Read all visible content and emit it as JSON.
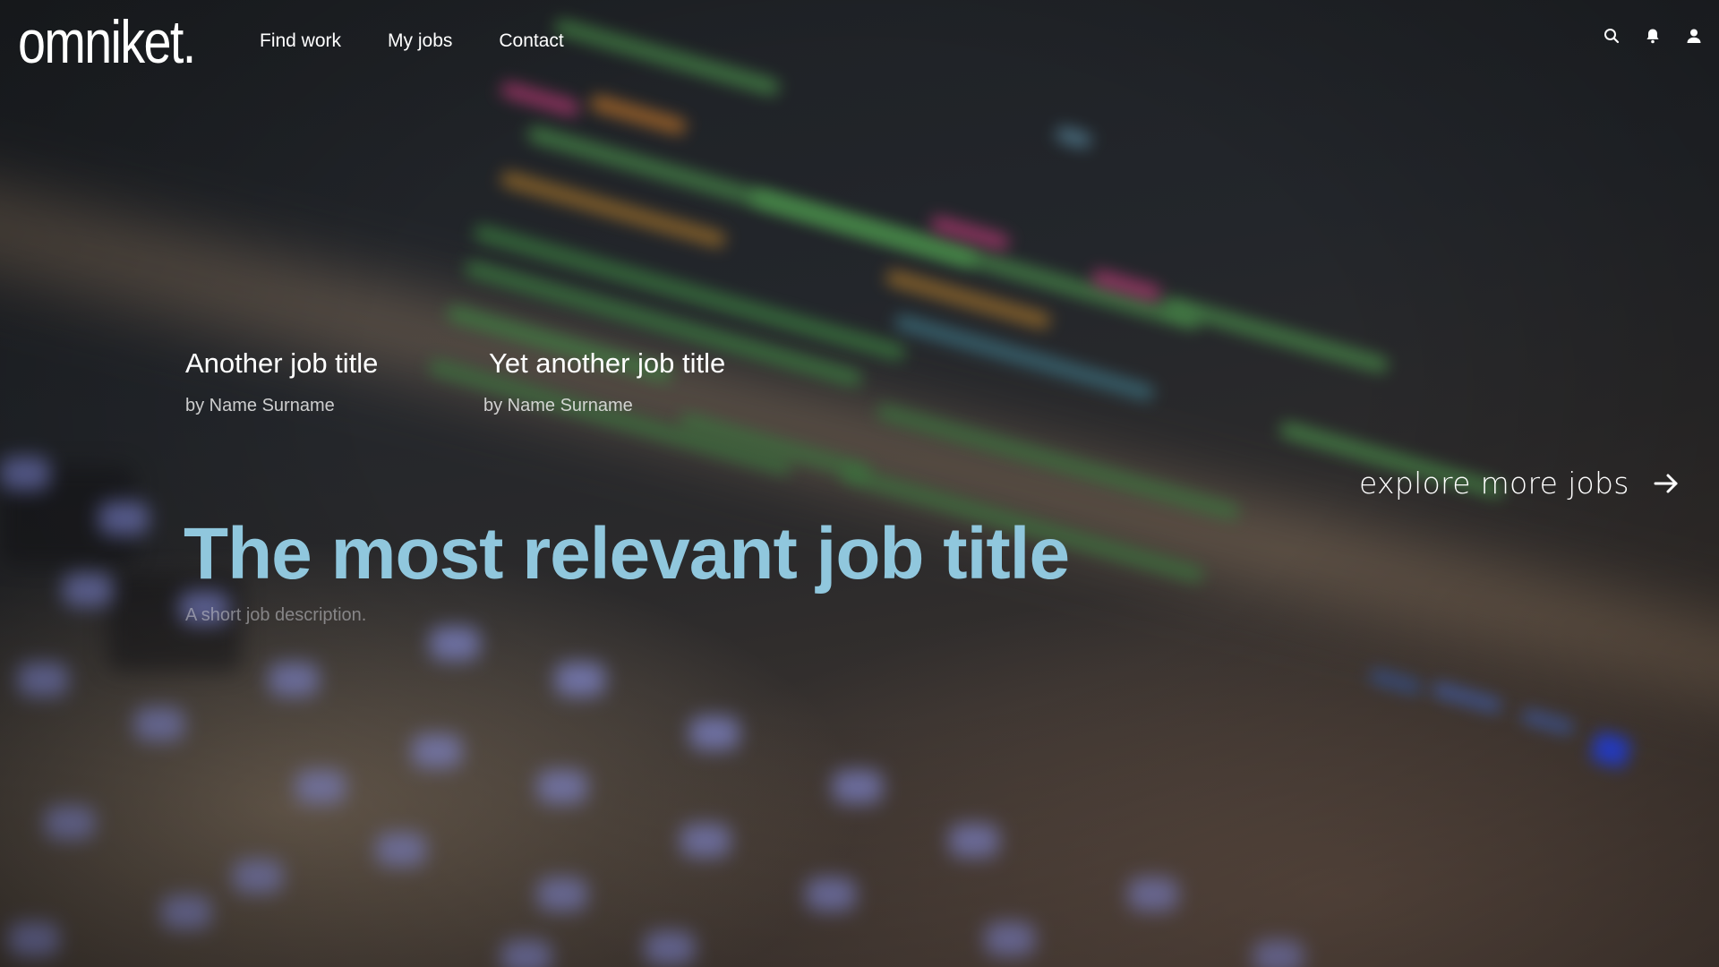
{
  "brand": {
    "logo_text": "omniket."
  },
  "nav": {
    "items": [
      {
        "label": "Find work"
      },
      {
        "label": "My jobs"
      },
      {
        "label": "Contact"
      }
    ]
  },
  "header_icons": [
    "search-icon",
    "bell-icon",
    "user-icon"
  ],
  "secondary_jobs": [
    {
      "title": "Another job title",
      "author": "by Name Surname"
    },
    {
      "title": "Yet another job title",
      "author": "by Name Surname"
    }
  ],
  "explore": {
    "label": "explore more jobs",
    "icon": "arrow-right-icon"
  },
  "hero": {
    "title": "The most relevant job title",
    "description": "A short job description."
  },
  "colors": {
    "hero_title": "#90c7dd",
    "text": "#ffffff",
    "background": "#1a1d22"
  }
}
